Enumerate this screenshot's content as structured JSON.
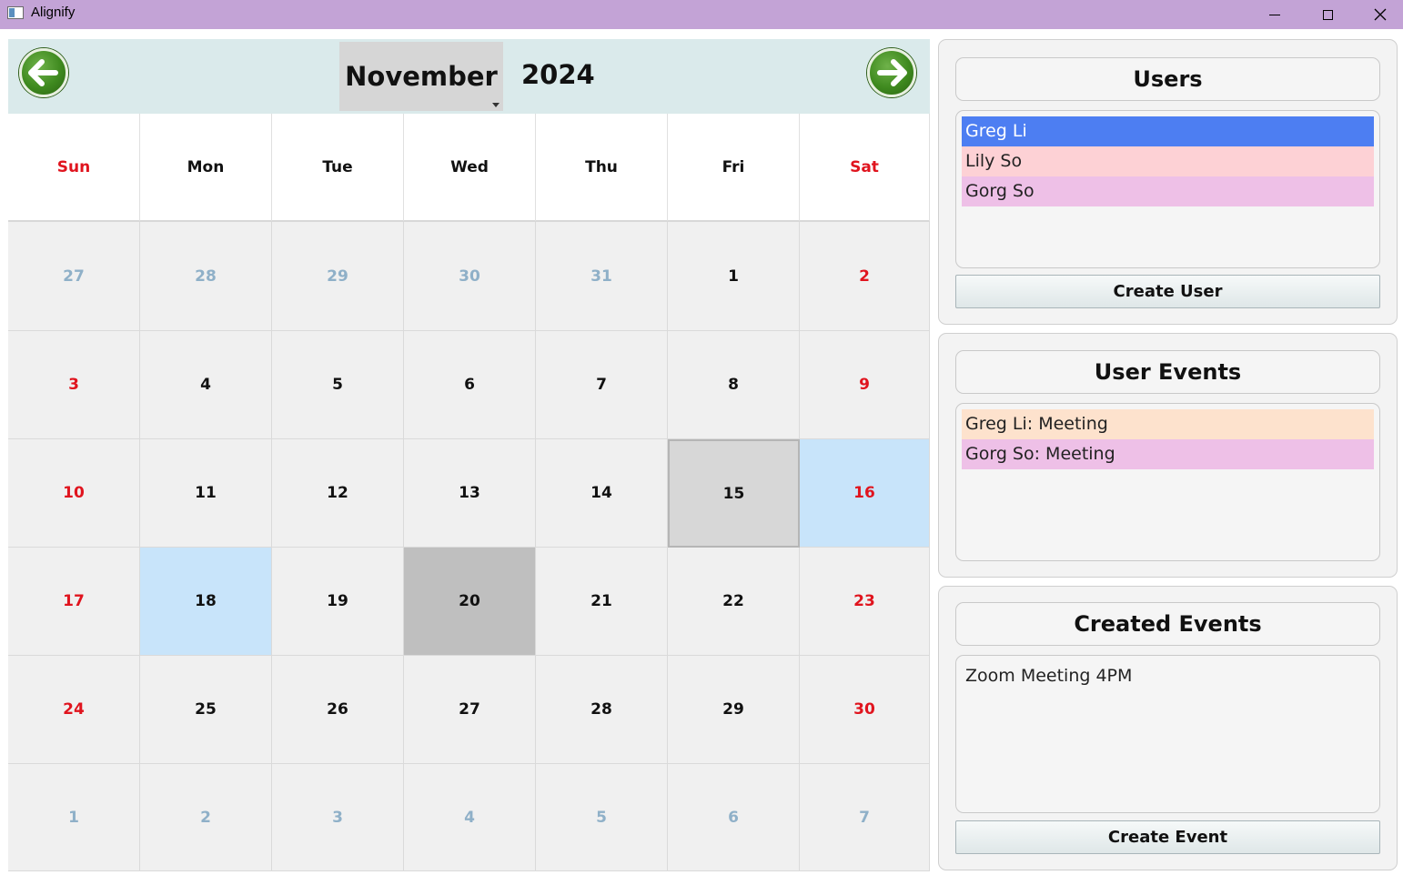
{
  "window": {
    "title": "Alignify"
  },
  "calendar": {
    "month": "November",
    "year": "2024",
    "weekdays": [
      "Sun",
      "Mon",
      "Tue",
      "Wed",
      "Thu",
      "Fri",
      "Sat"
    ],
    "weeks": [
      [
        "27",
        "28",
        "29",
        "30",
        "31",
        "1",
        "2"
      ],
      [
        "3",
        "4",
        "5",
        "6",
        "7",
        "8",
        "9"
      ],
      [
        "10",
        "11",
        "12",
        "13",
        "14",
        "15",
        "16"
      ],
      [
        "17",
        "18",
        "19",
        "20",
        "21",
        "22",
        "23"
      ],
      [
        "24",
        "25",
        "26",
        "27",
        "28",
        "29",
        "30"
      ],
      [
        "1",
        "2",
        "3",
        "4",
        "5",
        "6",
        "7"
      ]
    ]
  },
  "users_panel": {
    "title": "Users",
    "items": [
      {
        "label": "Greg Li",
        "color": "#4d7ef2",
        "text_color": "#ffffff"
      },
      {
        "label": "Lily So",
        "color": "#fdd1d5",
        "text_color": "#222222"
      },
      {
        "label": "Gorg So",
        "color": "#eec0e7",
        "text_color": "#222222"
      }
    ],
    "button": "Create User"
  },
  "user_events_panel": {
    "title": "User Events",
    "items": [
      {
        "label": "Greg Li: Meeting",
        "color": "#fde2cd"
      },
      {
        "label": "Gorg So: Meeting",
        "color": "#eec0e7"
      }
    ]
  },
  "created_events_panel": {
    "title": "Created Events",
    "items": [
      {
        "label": "Zoom Meeting 4PM"
      }
    ],
    "button": "Create Event"
  },
  "colors": {
    "titlebar": "#c3a3d6",
    "header": "#daeaeb",
    "weekend": "#e0141e",
    "other_month": "#8fb0c8",
    "highlight_blue": "#c8e4fa"
  }
}
